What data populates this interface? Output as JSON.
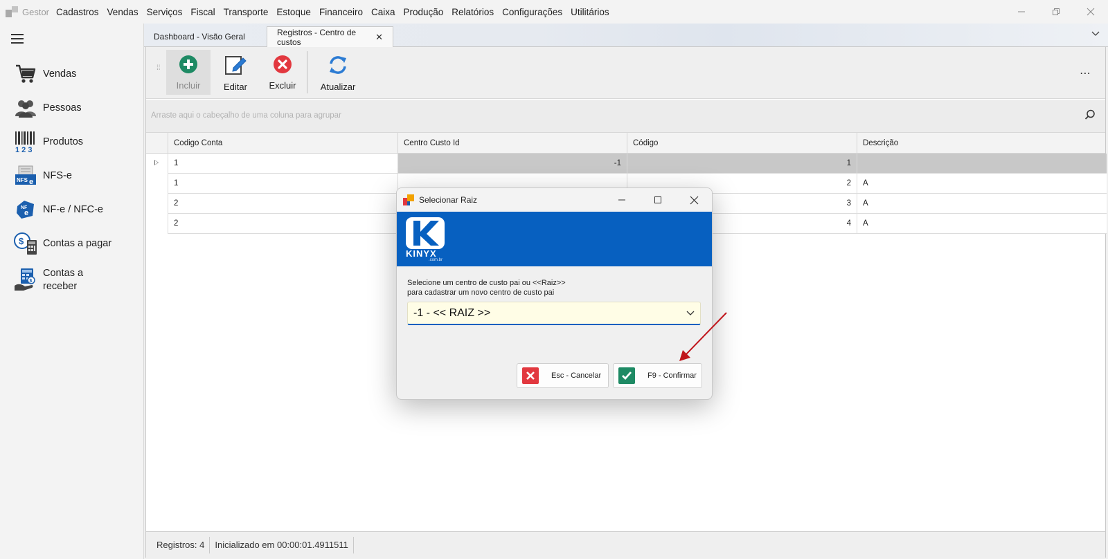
{
  "app": {
    "name": "Gestor",
    "menu": [
      "Cadastros",
      "Vendas",
      "Serviços",
      "Fiscal",
      "Transporte",
      "Estoque",
      "Financeiro",
      "Caixa",
      "Produção",
      "Relatórios",
      "Configurações",
      "Utilitários"
    ]
  },
  "sidebar": {
    "items": [
      {
        "label": "Vendas",
        "icon": "cart-icon"
      },
      {
        "label": "Pessoas",
        "icon": "people-icon"
      },
      {
        "label": "Produtos",
        "icon": "barcode-icon"
      },
      {
        "label": "NFS-e",
        "icon": "nfse-icon"
      },
      {
        "label": "NF-e / NFC-e",
        "icon": "nfe-icon"
      },
      {
        "label": "Contas a pagar",
        "icon": "bills-icon"
      },
      {
        "label": "Contas a\nreceber",
        "icon": "receivables-icon"
      }
    ]
  },
  "tabs": [
    {
      "label": "Dashboard - Visão Geral",
      "active": false
    },
    {
      "label": "Registros - Centro de custos",
      "active": true
    }
  ],
  "toolbar": {
    "add_label": "Incluir",
    "edit_label": "Editar",
    "delete_label": "Excluir",
    "refresh_label": "Atualizar",
    "more_label": "⋯"
  },
  "grid": {
    "group_hint": "Arraste aqui o cabeçalho de uma coluna para agrupar",
    "columns": [
      "Codigo Conta",
      "Centro Custo Id",
      "Código",
      "Descrição"
    ],
    "rows": [
      {
        "codigo_conta": "1",
        "centro_custo_id": "-1",
        "codigo": "1",
        "descricao": ""
      },
      {
        "codigo_conta": "1",
        "centro_custo_id": "",
        "codigo": "2",
        "descricao": "A"
      },
      {
        "codigo_conta": "2",
        "centro_custo_id": "",
        "codigo": "3",
        "descricao": "A"
      },
      {
        "codigo_conta": "2",
        "centro_custo_id": "",
        "codigo": "4",
        "descricao": "A"
      }
    ]
  },
  "status": {
    "records": "Registros: 4",
    "init_time": "Inicializado em 00:00:01.4911511"
  },
  "dialog": {
    "title": "Selecionar Raiz",
    "brand": "KINYX",
    "brand_sub": ".com.br",
    "prompt_line1": "Selecione um centro de custo pai ou <<Raiz>>",
    "prompt_line2": "para cadastrar um novo centro de custo pai",
    "select_value": "-1 - << RAIZ >>",
    "cancel_label": "Esc - Cancelar",
    "confirm_label": "F9 - Confirmar"
  },
  "colors": {
    "brand_blue": "#0760c0",
    "add_green": "#1e8a64",
    "delete_red": "#e2383f",
    "annotation_red": "#c0151b"
  }
}
